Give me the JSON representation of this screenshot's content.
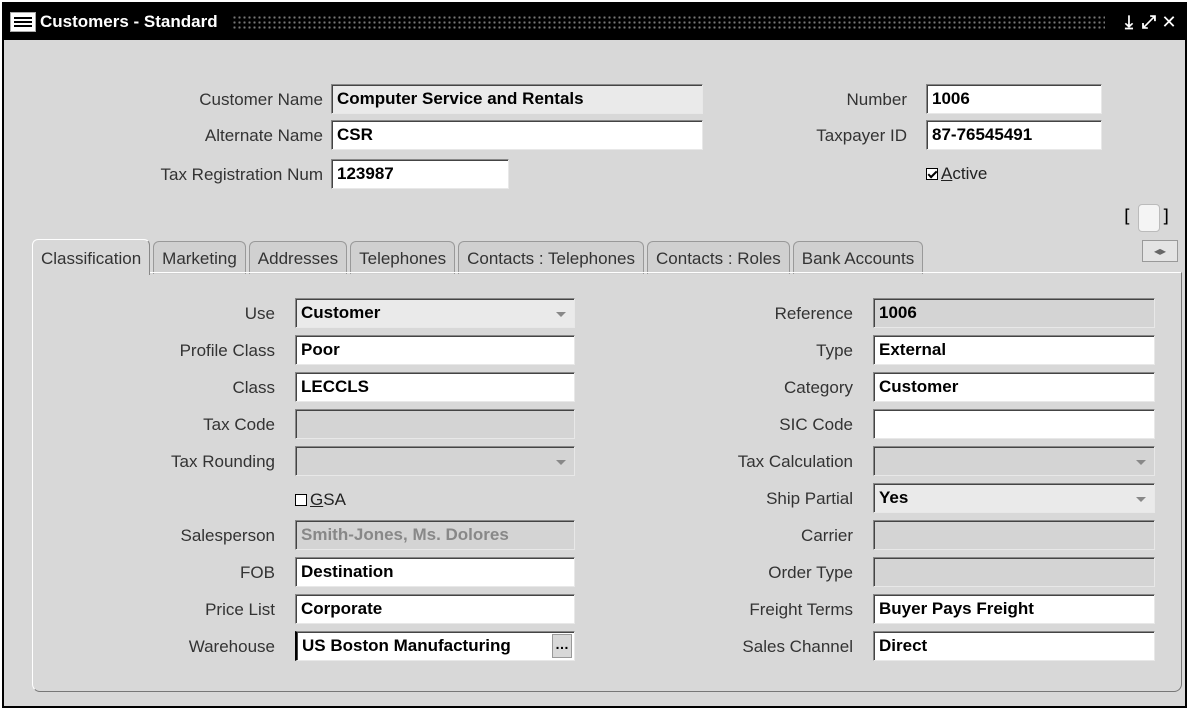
{
  "window": {
    "title": "Customers - Standard",
    "controls": {
      "minimize": "⤓",
      "maximize": "⤢",
      "close": "✕"
    }
  },
  "header": {
    "customer_name_label": "Customer Name",
    "customer_name_value": "Computer Service and Rentals",
    "alternate_name_label": "Alternate Name",
    "alternate_name_value": "CSR",
    "tax_registration_label": "Tax Registration Num",
    "tax_registration_value": "123987",
    "number_label": "Number",
    "number_value": "1006",
    "taxpayer_label": "Taxpayer ID",
    "taxpayer_value": "87-76545491",
    "active_prefix": "",
    "active_accel": "A",
    "active_rest": "ctive",
    "active_checked": true
  },
  "tabs": [
    {
      "label": "Classification",
      "active": true
    },
    {
      "label": "Marketing"
    },
    {
      "label": "Addresses"
    },
    {
      "label": "Telephones"
    },
    {
      "label": "Contacts : Telephones"
    },
    {
      "label": "Contacts : Roles"
    },
    {
      "label": "Bank Accounts"
    }
  ],
  "tab_scroll_icon": "◂▸",
  "left": {
    "use_label": "Use",
    "use_value": "Customer",
    "profile_class_label": "Profile Class",
    "profile_class_value": "Poor",
    "class_label": "Class",
    "class_value": "LECCLS",
    "tax_code_label": "Tax Code",
    "tax_code_value": "",
    "tax_rounding_label": "Tax Rounding",
    "tax_rounding_value": "",
    "gsa_accel": "G",
    "gsa_rest": "SA",
    "gsa_checked": false,
    "salesperson_label": "Salesperson",
    "salesperson_value": "Smith-Jones, Ms. Dolores",
    "fob_label": "FOB",
    "fob_value": "Destination",
    "price_list_label": "Price List",
    "price_list_value": "Corporate",
    "warehouse_label": "Warehouse",
    "warehouse_value": "US Boston Manufacturing",
    "lov_glyph": "…"
  },
  "right": {
    "reference_label": "Reference",
    "reference_value": "1006",
    "type_label": "Type",
    "type_value": "External",
    "category_label": "Category",
    "category_value": "Customer",
    "sic_code_label": "SIC Code",
    "sic_code_value": "",
    "tax_calculation_label": "Tax Calculation",
    "tax_calculation_value": "",
    "ship_partial_label": "Ship Partial",
    "ship_partial_value": "Yes",
    "carrier_label": "Carrier",
    "carrier_value": "",
    "order_type_label": "Order Type",
    "order_type_value": "",
    "freight_terms_label": "Freight Terms",
    "freight_terms_value": "Buyer Pays Freight",
    "sales_channel_label": "Sales Channel",
    "sales_channel_value": "Direct"
  }
}
